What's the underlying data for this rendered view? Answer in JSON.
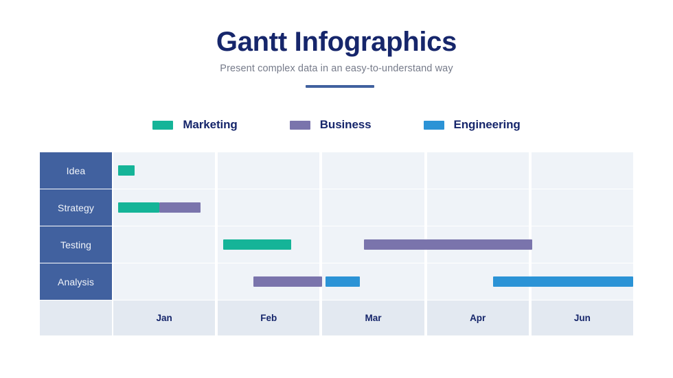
{
  "header": {
    "title": "Gantt Infographics",
    "subtitle": "Present complex data in an easy-to-understand way"
  },
  "legend": {
    "items": [
      {
        "label": "Marketing",
        "color": "#15b498"
      },
      {
        "label": "Business",
        "color": "#7a74ac"
      },
      {
        "label": "Engineering",
        "color": "#2b93d6"
      }
    ]
  },
  "chart_data": {
    "type": "bar",
    "title": "Gantt Infographics",
    "subtitle": "Present complex data in an easy-to-understand way",
    "xlabel": "",
    "ylabel": "",
    "grid": true,
    "legend_position": "top",
    "categories": [
      "Idea",
      "Strategy",
      "Testing",
      "Analysis"
    ],
    "x_tick_labels": [
      "Jan",
      "Feb",
      "Mar",
      "Apr",
      "Jun"
    ],
    "xlim": [
      0,
      5
    ],
    "series": [
      {
        "name": "Marketing",
        "color": "#15b498"
      },
      {
        "name": "Business",
        "color": "#7a74ac"
      },
      {
        "name": "Engineering",
        "color": "#2b93d6"
      }
    ],
    "tasks": [
      {
        "row": "Idea",
        "series": "Marketing",
        "color": "#15b498",
        "start": 0.05,
        "end": 0.21
      },
      {
        "row": "Strategy",
        "series": "Marketing",
        "color": "#15b498",
        "start": 0.05,
        "end": 0.45
      },
      {
        "row": "Strategy",
        "series": "Business",
        "color": "#7a74ac",
        "start": 0.45,
        "end": 0.86
      },
      {
        "row": "Testing",
        "series": "Marketing",
        "color": "#15b498",
        "start": 1.05,
        "end": 1.72
      },
      {
        "row": "Testing",
        "series": "Business",
        "color": "#7a74ac",
        "start": 2.41,
        "end": 4.01
      },
      {
        "row": "Analysis",
        "series": "Business",
        "color": "#7a74ac",
        "start": 1.35,
        "end": 2.0
      },
      {
        "row": "Analysis",
        "series": "Engineering",
        "color": "#2b93d6",
        "start": 2.03,
        "end": 2.37
      },
      {
        "row": "Analysis",
        "series": "Engineering",
        "color": "#2b93d6",
        "start": 3.65,
        "end": 5.0
      }
    ]
  },
  "rows": [
    {
      "label": "Idea"
    },
    {
      "label": "Strategy"
    },
    {
      "label": "Testing"
    },
    {
      "label": "Analysis"
    }
  ],
  "months": [
    "Jan",
    "Feb",
    "Mar",
    "Apr",
    "Jun"
  ],
  "colors": {
    "title": "#16266b",
    "subtitle": "#767b8a",
    "rule": "#41619f",
    "row_label_bg": "#41619f",
    "row_label_text": "#f2f5fa",
    "cell_bg": "#eff3f8",
    "month_bg": "#e3e9f1",
    "month_text": "#16266b"
  }
}
